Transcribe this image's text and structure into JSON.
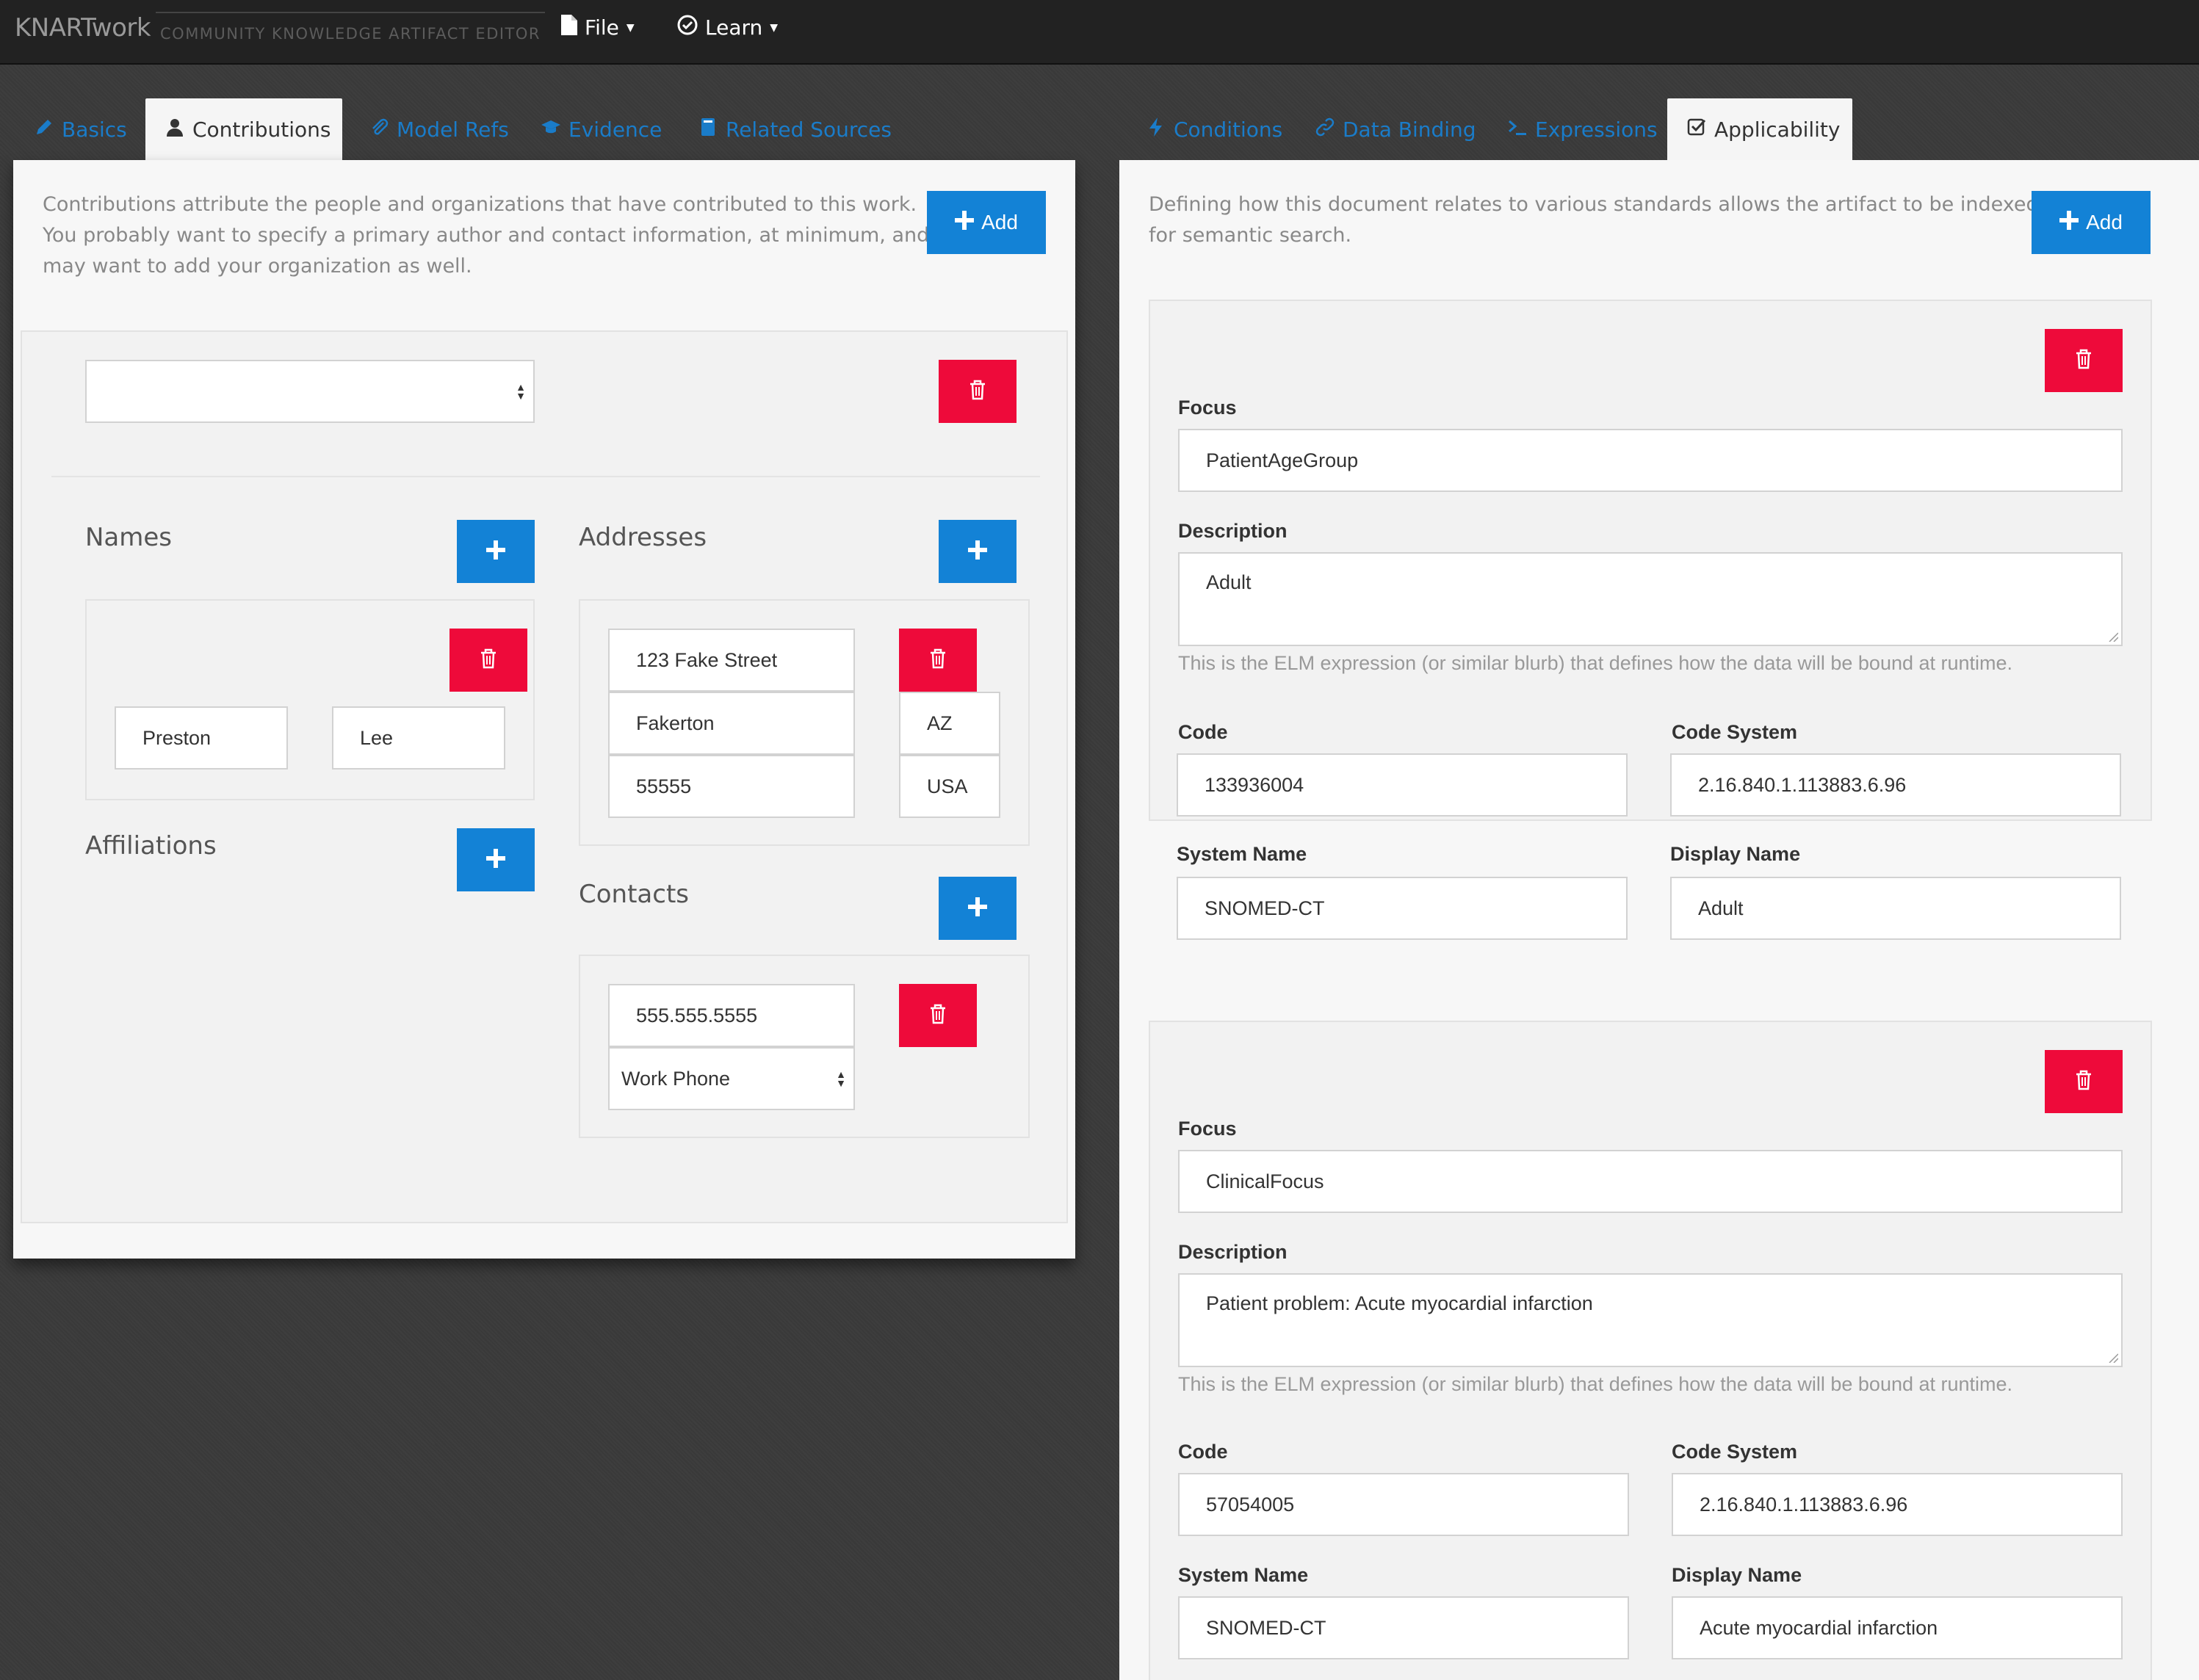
{
  "app": {
    "brand_main": "KNART",
    "brand_work": "work",
    "brand_sub": "COMMUNITY KNOWLEDGE ARTIFACT EDITOR",
    "menus": [
      {
        "label": "File",
        "icon": "file-icon"
      },
      {
        "label": "Learn",
        "icon": "check-circle-icon"
      }
    ]
  },
  "left": {
    "tabs": [
      {
        "label": "Basics",
        "icon": "pencil-icon",
        "active": false
      },
      {
        "label": "Contributions",
        "icon": "user-icon",
        "active": true
      },
      {
        "label": "Model Refs",
        "icon": "paperclip-icon",
        "active": false
      },
      {
        "label": "Evidence",
        "icon": "graduation-cap-icon",
        "active": false
      },
      {
        "label": "Related Sources",
        "icon": "book-icon",
        "active": false
      }
    ],
    "description": "Contributions attribute the people and organizations that have contributed to this work. You probably want to specify a primary author and contact information, at minimum, and may want to add your organization as well.",
    "add_label": "Add",
    "contribution": {
      "type_select_value": "",
      "names_title": "Names",
      "name": {
        "first": "Preston",
        "last": "Lee"
      },
      "affiliations_title": "Affiliations",
      "addresses_title": "Addresses",
      "address": {
        "street": "123 Fake Street",
        "city": "Fakerton",
        "state": "AZ",
        "postal": "55555",
        "country": "USA"
      },
      "contacts_title": "Contacts",
      "contact": {
        "value": "555.555.5555",
        "type": "Work Phone"
      }
    }
  },
  "right": {
    "tabs": [
      {
        "label": "Conditions",
        "icon": "bolt-icon",
        "active": false
      },
      {
        "label": "Data Binding",
        "icon": "link-icon",
        "active": false
      },
      {
        "label": "Expressions",
        "icon": "terminal-icon",
        "active": false
      },
      {
        "label": "Applicability",
        "icon": "check-square-icon",
        "active": true
      }
    ],
    "description": "Defining how this document relates to various standards allows the artifact to be indexed for semantic search.",
    "add_label": "Add",
    "labels": {
      "focus": "Focus",
      "description": "Description",
      "help": "This is the ELM expression (or similar blurb) that defines how the data will be bound at runtime.",
      "code": "Code",
      "code_system": "Code System",
      "system_name": "System Name",
      "display_name": "Display Name"
    },
    "items": [
      {
        "focus": "PatientAgeGroup",
        "description": "Adult",
        "code": "133936004",
        "code_system": "2.16.840.1.113883.6.96",
        "system_name": "SNOMED-CT",
        "display_name": "Adult"
      },
      {
        "focus": "ClinicalFocus",
        "description": "Patient problem: Acute myocardial infarction",
        "code": "57054005",
        "code_system": "2.16.840.1.113883.6.96",
        "system_name": "SNOMED-CT",
        "display_name": "Acute myocardial infarction"
      }
    ]
  },
  "colors": {
    "primary": "#1382d6",
    "danger": "#ee0a3a",
    "navbar": "#222222",
    "link": "#1a7cc9"
  }
}
